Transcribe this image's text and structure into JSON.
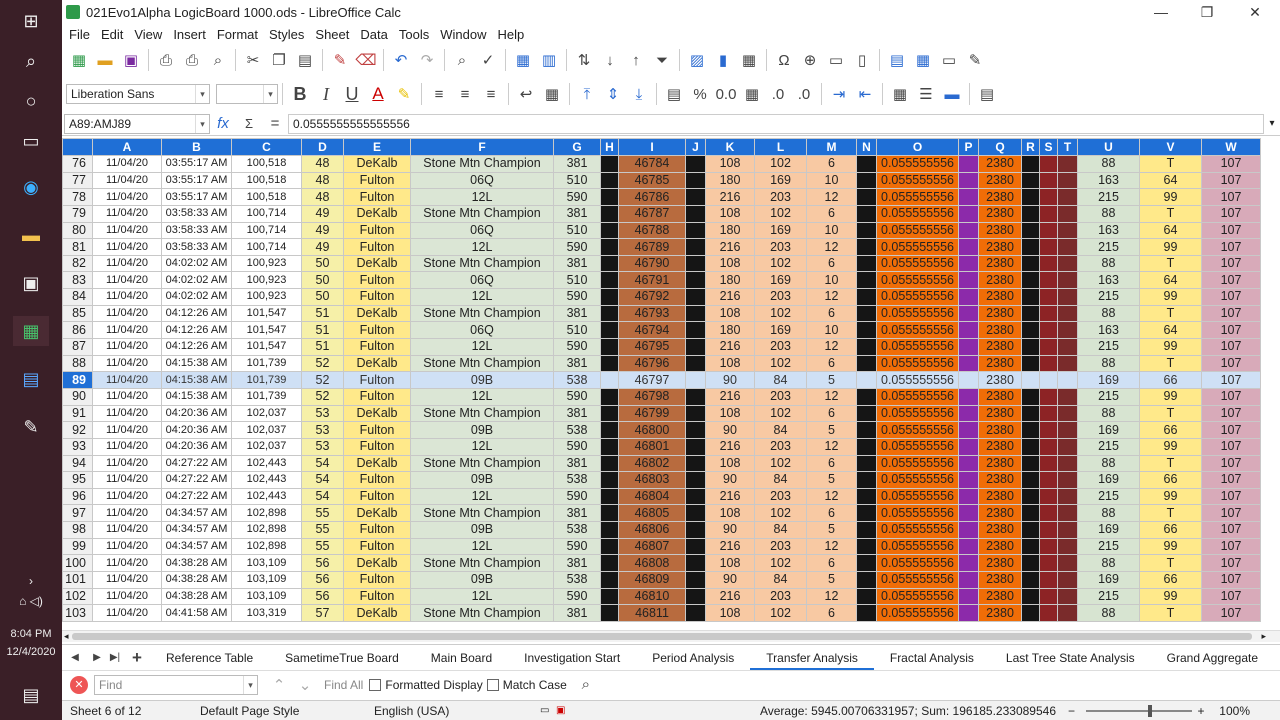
{
  "taskbar": {
    "time": "8:04 PM",
    "date": "12/4/2020"
  },
  "window": {
    "title": "021Evo1Alpha LogicBoard 1000.ods - LibreOffice Calc"
  },
  "menu": [
    "File",
    "Edit",
    "View",
    "Insert",
    "Format",
    "Styles",
    "Sheet",
    "Data",
    "Tools",
    "Window",
    "Help"
  ],
  "font": {
    "name": "Liberation Sans",
    "size": ""
  },
  "formula": {
    "cell_ref": "A89:AMJ89",
    "value": "0.0555555555555556"
  },
  "columns": [
    "A",
    "B",
    "C",
    "D",
    "E",
    "F",
    "G",
    "H",
    "I",
    "J",
    "K",
    "L",
    "M",
    "N",
    "O",
    "P",
    "Q",
    "R",
    "S",
    "T",
    "U",
    "V",
    "W"
  ],
  "rows": [
    [
      "76",
      "11/04/20",
      "03:55:17 AM",
      "100,518",
      "48",
      "DeKalb",
      "Stone Mtn Champion",
      "381",
      "",
      "46784",
      "",
      "108",
      "102",
      "6",
      "",
      "0.055555556",
      "",
      "2380",
      "",
      "",
      "",
      "88",
      "T",
      "107"
    ],
    [
      "77",
      "11/04/20",
      "03:55:17 AM",
      "100,518",
      "48",
      "Fulton",
      "06Q",
      "510",
      "",
      "46785",
      "",
      "180",
      "169",
      "10",
      "",
      "0.055555556",
      "",
      "2380",
      "",
      "",
      "",
      "163",
      "64",
      "107"
    ],
    [
      "78",
      "11/04/20",
      "03:55:17 AM",
      "100,518",
      "48",
      "Fulton",
      "12L",
      "590",
      "",
      "46786",
      "",
      "216",
      "203",
      "12",
      "",
      "0.055555556",
      "",
      "2380",
      "",
      "",
      "",
      "215",
      "99",
      "107"
    ],
    [
      "79",
      "11/04/20",
      "03:58:33 AM",
      "100,714",
      "49",
      "DeKalb",
      "Stone Mtn Champion",
      "381",
      "",
      "46787",
      "",
      "108",
      "102",
      "6",
      "",
      "0.055555556",
      "",
      "2380",
      "",
      "",
      "",
      "88",
      "T",
      "107"
    ],
    [
      "80",
      "11/04/20",
      "03:58:33 AM",
      "100,714",
      "49",
      "Fulton",
      "06Q",
      "510",
      "",
      "46788",
      "",
      "180",
      "169",
      "10",
      "",
      "0.055555556",
      "",
      "2380",
      "",
      "",
      "",
      "163",
      "64",
      "107"
    ],
    [
      "81",
      "11/04/20",
      "03:58:33 AM",
      "100,714",
      "49",
      "Fulton",
      "12L",
      "590",
      "",
      "46789",
      "",
      "216",
      "203",
      "12",
      "",
      "0.055555556",
      "",
      "2380",
      "",
      "",
      "",
      "215",
      "99",
      "107"
    ],
    [
      "82",
      "11/04/20",
      "04:02:02 AM",
      "100,923",
      "50",
      "DeKalb",
      "Stone Mtn Champion",
      "381",
      "",
      "46790",
      "",
      "108",
      "102",
      "6",
      "",
      "0.055555556",
      "",
      "2380",
      "",
      "",
      "",
      "88",
      "T",
      "107"
    ],
    [
      "83",
      "11/04/20",
      "04:02:02 AM",
      "100,923",
      "50",
      "Fulton",
      "06Q",
      "510",
      "",
      "46791",
      "",
      "180",
      "169",
      "10",
      "",
      "0.055555556",
      "",
      "2380",
      "",
      "",
      "",
      "163",
      "64",
      "107"
    ],
    [
      "84",
      "11/04/20",
      "04:02:02 AM",
      "100,923",
      "50",
      "Fulton",
      "12L",
      "590",
      "",
      "46792",
      "",
      "216",
      "203",
      "12",
      "",
      "0.055555556",
      "",
      "2380",
      "",
      "",
      "",
      "215",
      "99",
      "107"
    ],
    [
      "85",
      "11/04/20",
      "04:12:26 AM",
      "101,547",
      "51",
      "DeKalb",
      "Stone Mtn Champion",
      "381",
      "",
      "46793",
      "",
      "108",
      "102",
      "6",
      "",
      "0.055555556",
      "",
      "2380",
      "",
      "",
      "",
      "88",
      "T",
      "107"
    ],
    [
      "86",
      "11/04/20",
      "04:12:26 AM",
      "101,547",
      "51",
      "Fulton",
      "06Q",
      "510",
      "",
      "46794",
      "",
      "180",
      "169",
      "10",
      "",
      "0.055555556",
      "",
      "2380",
      "",
      "",
      "",
      "163",
      "64",
      "107"
    ],
    [
      "87",
      "11/04/20",
      "04:12:26 AM",
      "101,547",
      "51",
      "Fulton",
      "12L",
      "590",
      "",
      "46795",
      "",
      "216",
      "203",
      "12",
      "",
      "0.055555556",
      "",
      "2380",
      "",
      "",
      "",
      "215",
      "99",
      "107"
    ],
    [
      "88",
      "11/04/20",
      "04:15:38 AM",
      "101,739",
      "52",
      "DeKalb",
      "Stone Mtn Champion",
      "381",
      "",
      "46796",
      "",
      "108",
      "102",
      "6",
      "",
      "0.055555556",
      "",
      "2380",
      "",
      "",
      "",
      "88",
      "T",
      "107"
    ],
    [
      "89",
      "11/04/20",
      "04:15:38 AM",
      "101,739",
      "52",
      "Fulton",
      "09B",
      "538",
      "",
      "46797",
      "",
      "90",
      "84",
      "5",
      "",
      "0.055555556",
      "",
      "2380",
      "",
      "",
      "",
      "169",
      "66",
      "107"
    ],
    [
      "90",
      "11/04/20",
      "04:15:38 AM",
      "101,739",
      "52",
      "Fulton",
      "12L",
      "590",
      "",
      "46798",
      "",
      "216",
      "203",
      "12",
      "",
      "0.055555556",
      "",
      "2380",
      "",
      "",
      "",
      "215",
      "99",
      "107"
    ],
    [
      "91",
      "11/04/20",
      "04:20:36 AM",
      "102,037",
      "53",
      "DeKalb",
      "Stone Mtn Champion",
      "381",
      "",
      "46799",
      "",
      "108",
      "102",
      "6",
      "",
      "0.055555556",
      "",
      "2380",
      "",
      "",
      "",
      "88",
      "T",
      "107"
    ],
    [
      "92",
      "11/04/20",
      "04:20:36 AM",
      "102,037",
      "53",
      "Fulton",
      "09B",
      "538",
      "",
      "46800",
      "",
      "90",
      "84",
      "5",
      "",
      "0.055555556",
      "",
      "2380",
      "",
      "",
      "",
      "169",
      "66",
      "107"
    ],
    [
      "93",
      "11/04/20",
      "04:20:36 AM",
      "102,037",
      "53",
      "Fulton",
      "12L",
      "590",
      "",
      "46801",
      "",
      "216",
      "203",
      "12",
      "",
      "0.055555556",
      "",
      "2380",
      "",
      "",
      "",
      "215",
      "99",
      "107"
    ],
    [
      "94",
      "11/04/20",
      "04:27:22 AM",
      "102,443",
      "54",
      "DeKalb",
      "Stone Mtn Champion",
      "381",
      "",
      "46802",
      "",
      "108",
      "102",
      "6",
      "",
      "0.055555556",
      "",
      "2380",
      "",
      "",
      "",
      "88",
      "T",
      "107"
    ],
    [
      "95",
      "11/04/20",
      "04:27:22 AM",
      "102,443",
      "54",
      "Fulton",
      "09B",
      "538",
      "",
      "46803",
      "",
      "90",
      "84",
      "5",
      "",
      "0.055555556",
      "",
      "2380",
      "",
      "",
      "",
      "169",
      "66",
      "107"
    ],
    [
      "96",
      "11/04/20",
      "04:27:22 AM",
      "102,443",
      "54",
      "Fulton",
      "12L",
      "590",
      "",
      "46804",
      "",
      "216",
      "203",
      "12",
      "",
      "0.055555556",
      "",
      "2380",
      "",
      "",
      "",
      "215",
      "99",
      "107"
    ],
    [
      "97",
      "11/04/20",
      "04:34:57 AM",
      "102,898",
      "55",
      "DeKalb",
      "Stone Mtn Champion",
      "381",
      "",
      "46805",
      "",
      "108",
      "102",
      "6",
      "",
      "0.055555556",
      "",
      "2380",
      "",
      "",
      "",
      "88",
      "T",
      "107"
    ],
    [
      "98",
      "11/04/20",
      "04:34:57 AM",
      "102,898",
      "55",
      "Fulton",
      "09B",
      "538",
      "",
      "46806",
      "",
      "90",
      "84",
      "5",
      "",
      "0.055555556",
      "",
      "2380",
      "",
      "",
      "",
      "169",
      "66",
      "107"
    ],
    [
      "99",
      "11/04/20",
      "04:34:57 AM",
      "102,898",
      "55",
      "Fulton",
      "12L",
      "590",
      "",
      "46807",
      "",
      "216",
      "203",
      "12",
      "",
      "0.055555556",
      "",
      "2380",
      "",
      "",
      "",
      "215",
      "99",
      "107"
    ],
    [
      "100",
      "11/04/20",
      "04:38:28 AM",
      "103,109",
      "56",
      "DeKalb",
      "Stone Mtn Champion",
      "381",
      "",
      "46808",
      "",
      "108",
      "102",
      "6",
      "",
      "0.055555556",
      "",
      "2380",
      "",
      "",
      "",
      "88",
      "T",
      "107"
    ],
    [
      "101",
      "11/04/20",
      "04:38:28 AM",
      "103,109",
      "56",
      "Fulton",
      "09B",
      "538",
      "",
      "46809",
      "",
      "90",
      "84",
      "5",
      "",
      "0.055555556",
      "",
      "2380",
      "",
      "",
      "",
      "169",
      "66",
      "107"
    ],
    [
      "102",
      "11/04/20",
      "04:38:28 AM",
      "103,109",
      "56",
      "Fulton",
      "12L",
      "590",
      "",
      "46810",
      "",
      "216",
      "203",
      "12",
      "",
      "0.055555556",
      "",
      "2380",
      "",
      "",
      "",
      "215",
      "99",
      "107"
    ],
    [
      "103",
      "11/04/20",
      "04:41:58 AM",
      "103,319",
      "57",
      "DeKalb",
      "Stone Mtn Champion",
      "381",
      "",
      "46811",
      "",
      "108",
      "102",
      "6",
      "",
      "0.055555556",
      "",
      "2380",
      "",
      "",
      "",
      "88",
      "T",
      "107"
    ]
  ],
  "selected_row": "89",
  "sheet_tabs": [
    "Reference Table",
    "SametimeTrue Board",
    "Main Board",
    "Investigation Start",
    "Period Analysis",
    "Transfer Analysis",
    "Fractal Analysis",
    "Last Tree State Analysis",
    "Grand Aggregate"
  ],
  "active_tab": "Transfer Analysis",
  "find": {
    "placeholder": "Find",
    "find_all": "Find All",
    "formatted_display": "Formatted Display",
    "match_case": "Match Case"
  },
  "status": {
    "sheet": "Sheet 6 of 12",
    "page_style": "Default Page Style",
    "language": "English (USA)",
    "summary": "Average: 5945.00706331957; Sum: 196185.233089546",
    "zoom": "100%"
  }
}
